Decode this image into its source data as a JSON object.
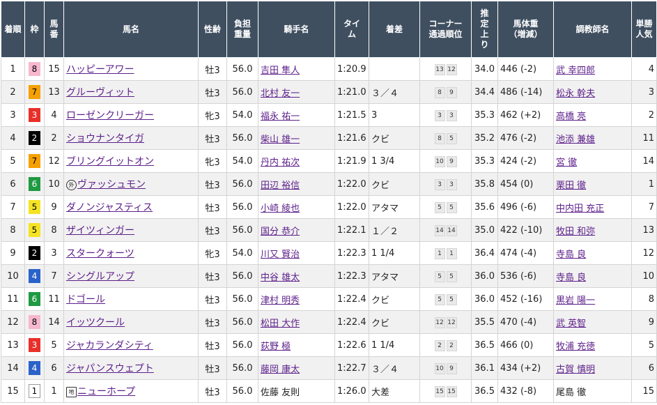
{
  "headers": {
    "rank": [
      "着順"
    ],
    "waku": [
      "枠"
    ],
    "umaban": [
      "馬",
      "番"
    ],
    "name": [
      "馬名"
    ],
    "sexage": [
      "性齢"
    ],
    "weight": [
      "負担",
      "重量"
    ],
    "jockey": [
      "騎手名"
    ],
    "time": [
      "タイ",
      "ム"
    ],
    "margin": [
      "着差"
    ],
    "corner": [
      "コーナー",
      "通過順位"
    ],
    "last3f": [
      "推",
      "定",
      "上",
      "り"
    ],
    "bodyweight": [
      "馬体重",
      "（増減）"
    ],
    "trainer": [
      "調教師名"
    ],
    "pop": [
      "単勝",
      "人気"
    ]
  },
  "waku_colors": {
    "1": {
      "bg": "#ffffff",
      "fg": "#000000",
      "border": "#999999"
    },
    "2": {
      "bg": "#000000",
      "fg": "#ffffff",
      "border": "#000000"
    },
    "3": {
      "bg": "#e8302a",
      "fg": "#ffffff",
      "border": "#e8302a"
    },
    "4": {
      "bg": "#2a62c9",
      "fg": "#ffffff",
      "border": "#2a62c9"
    },
    "5": {
      "bg": "#f5e323",
      "fg": "#000000",
      "border": "#f5e323"
    },
    "6": {
      "bg": "#1f9a42",
      "fg": "#ffffff",
      "border": "#1f9a42"
    },
    "7": {
      "bg": "#f5a000",
      "fg": "#000000",
      "border": "#f5a000"
    },
    "8": {
      "bg": "#f6b8cf",
      "fg": "#000000",
      "border": "#f6b8cf"
    }
  },
  "rows": [
    {
      "rank": "1",
      "waku": "8",
      "umaban": "15",
      "mark": "",
      "name": "ハッピーアワー",
      "name_link": true,
      "sex": "牡3",
      "weight": "56.0",
      "jockey": "吉田 隼人",
      "jockey_link": true,
      "time": "1:20.9",
      "margin": "",
      "corner": [
        "13",
        "12"
      ],
      "last3f": "34.0",
      "bw": "446 (-2)",
      "trainer": "武 幸四郎",
      "trainer_link": true,
      "pop": "4"
    },
    {
      "rank": "2",
      "waku": "7",
      "umaban": "13",
      "mark": "",
      "name": "グルーヴィット",
      "name_link": true,
      "sex": "牡3",
      "weight": "56.0",
      "jockey": "北村 友一",
      "jockey_link": true,
      "time": "1:21.0",
      "margin": "３／４",
      "corner": [
        "8",
        "9"
      ],
      "last3f": "34.4",
      "bw": "486 (-14)",
      "trainer": "松永 幹夫",
      "trainer_link": true,
      "pop": "3"
    },
    {
      "rank": "3",
      "waku": "3",
      "umaban": "4",
      "mark": "",
      "name": "ローゼンクリーガー",
      "name_link": true,
      "sex": "牝3",
      "weight": "54.0",
      "jockey": "福永 祐一",
      "jockey_link": true,
      "time": "1:21.5",
      "margin": "3",
      "corner": [
        "3",
        "3"
      ],
      "last3f": "35.3",
      "bw": "462 (+2)",
      "trainer": "高橋 亮",
      "trainer_link": true,
      "pop": "2"
    },
    {
      "rank": "4",
      "waku": "2",
      "umaban": "2",
      "mark": "",
      "name": "ショウナンタイガ",
      "name_link": true,
      "sex": "牡3",
      "weight": "56.0",
      "jockey": "柴山 雄一",
      "jockey_link": true,
      "time": "1:21.6",
      "margin": "クビ",
      "corner": [
        "8",
        "5"
      ],
      "last3f": "35.2",
      "bw": "476 (-2)",
      "trainer": "池添 兼雄",
      "trainer_link": true,
      "pop": "11"
    },
    {
      "rank": "5",
      "waku": "7",
      "umaban": "12",
      "mark": "",
      "name": "ブリングイットオン",
      "name_link": true,
      "sex": "牝3",
      "weight": "54.0",
      "jockey": "丹内 祐次",
      "jockey_link": true,
      "time": "1:21.9",
      "margin": "1 3/4",
      "corner": [
        "10",
        "9"
      ],
      "last3f": "35.3",
      "bw": "424 (-2)",
      "trainer": "宮 徹",
      "trainer_link": true,
      "pop": "14"
    },
    {
      "rank": "6",
      "waku": "6",
      "umaban": "10",
      "mark": "外",
      "mark_shape": "circle",
      "name": "ヴァッシュモン",
      "name_link": true,
      "sex": "牡3",
      "weight": "56.0",
      "jockey": "田辺 裕信",
      "jockey_link": true,
      "time": "1:22.0",
      "margin": "クビ",
      "corner": [
        "3",
        "3"
      ],
      "last3f": "35.8",
      "bw": "454 (0)",
      "trainer": "栗田 徹",
      "trainer_link": true,
      "pop": "1"
    },
    {
      "rank": "7",
      "waku": "5",
      "umaban": "9",
      "mark": "",
      "name": "ダノンジャスティス",
      "name_link": true,
      "sex": "牡3",
      "weight": "56.0",
      "jockey": "小崎 綾也",
      "jockey_link": true,
      "time": "1:22.0",
      "margin": "アタマ",
      "corner": [
        "5",
        "5"
      ],
      "last3f": "35.6",
      "bw": "496 (-6)",
      "trainer": "中内田 充正",
      "trainer_link": true,
      "pop": "7"
    },
    {
      "rank": "8",
      "waku": "5",
      "umaban": "8",
      "mark": "",
      "name": "ザイツィンガー",
      "name_link": true,
      "sex": "牡3",
      "weight": "56.0",
      "jockey": "国分 恭介",
      "jockey_link": true,
      "time": "1:22.1",
      "margin": "１／２",
      "corner": [
        "14",
        "14"
      ],
      "last3f": "35.0",
      "bw": "422 (-10)",
      "trainer": "牧田 和弥",
      "trainer_link": true,
      "pop": "13"
    },
    {
      "rank": "9",
      "waku": "2",
      "umaban": "3",
      "mark": "",
      "name": "スタークォーツ",
      "name_link": true,
      "sex": "牝3",
      "weight": "54.0",
      "jockey": "川又 賢治",
      "jockey_link": true,
      "time": "1:22.3",
      "margin": "1 1/4",
      "corner": [
        "1",
        "1"
      ],
      "last3f": "36.4",
      "bw": "474 (-4)",
      "trainer": "寺島 良",
      "trainer_link": true,
      "pop": "12"
    },
    {
      "rank": "10",
      "waku": "4",
      "umaban": "7",
      "mark": "",
      "name": "シングルアップ",
      "name_link": true,
      "sex": "牡3",
      "weight": "56.0",
      "jockey": "中谷 雄太",
      "jockey_link": true,
      "time": "1:22.3",
      "margin": "アタマ",
      "corner": [
        "5",
        "5"
      ],
      "last3f": "36.0",
      "bw": "536 (-6)",
      "trainer": "寺島 良",
      "trainer_link": true,
      "pop": "10"
    },
    {
      "rank": "11",
      "waku": "6",
      "umaban": "11",
      "mark": "",
      "name": "ドゴール",
      "name_link": true,
      "sex": "牡3",
      "weight": "56.0",
      "jockey": "津村 明秀",
      "jockey_link": true,
      "time": "1:22.4",
      "margin": "クビ",
      "corner": [
        "5",
        "5"
      ],
      "last3f": "36.0",
      "bw": "452 (-16)",
      "trainer": "黒岩 陽一",
      "trainer_link": true,
      "pop": "8"
    },
    {
      "rank": "12",
      "waku": "8",
      "umaban": "14",
      "mark": "",
      "name": "イッツクール",
      "name_link": true,
      "sex": "牡3",
      "weight": "56.0",
      "jockey": "松田 大作",
      "jockey_link": true,
      "time": "1:22.4",
      "margin": "クビ",
      "corner": [
        "12",
        "12"
      ],
      "last3f": "35.5",
      "bw": "470 (-4)",
      "trainer": "武 英智",
      "trainer_link": true,
      "pop": "9"
    },
    {
      "rank": "13",
      "waku": "3",
      "umaban": "5",
      "mark": "",
      "name": "ジャカランダシティ",
      "name_link": true,
      "sex": "牡3",
      "weight": "56.0",
      "jockey": "荻野 極",
      "jockey_link": true,
      "time": "1:22.6",
      "margin": "1 1/4",
      "corner": [
        "2",
        "2"
      ],
      "last3f": "36.5",
      "bw": "466 (0)",
      "trainer": "牧浦 充徳",
      "trainer_link": true,
      "pop": "5"
    },
    {
      "rank": "14",
      "waku": "4",
      "umaban": "6",
      "mark": "",
      "name": "ジャパンスウェプト",
      "name_link": true,
      "sex": "牡3",
      "weight": "56.0",
      "jockey": "藤岡 康太",
      "jockey_link": true,
      "time": "1:22.7",
      "margin": "３／４",
      "corner": [
        "10",
        "9"
      ],
      "last3f": "36.1",
      "bw": "434 (+2)",
      "trainer": "古賀 慎明",
      "trainer_link": true,
      "pop": "6"
    },
    {
      "rank": "15",
      "waku": "1",
      "umaban": "1",
      "mark": "地",
      "mark_shape": "square",
      "name": "ニューホープ",
      "name_link": true,
      "sex": "牡3",
      "weight": "56.0",
      "jockey": "佐藤 友則",
      "jockey_link": false,
      "time": "1:26.0",
      "margin": "大差",
      "corner": [
        "15",
        "15"
      ],
      "last3f": "36.5",
      "bw": "432 (-8)",
      "trainer": "尾島 徹",
      "trainer_link": false,
      "pop": "15"
    }
  ]
}
